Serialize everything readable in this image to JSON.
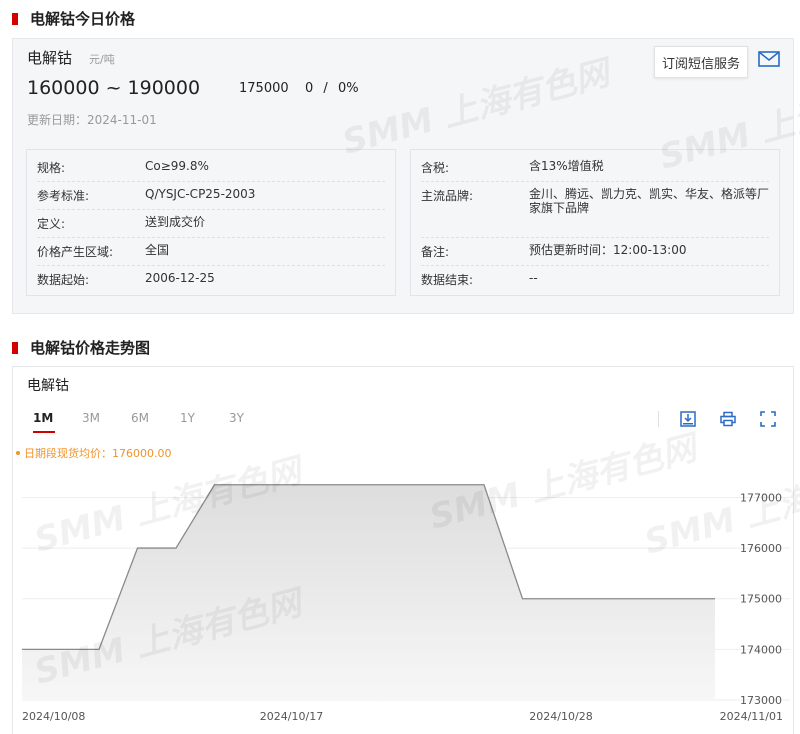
{
  "sections": {
    "price_title": "电解钴今日价格",
    "trend_title": "电解钴价格走势图"
  },
  "product": {
    "name": "电解钴",
    "unit": "元/吨",
    "price_low": "160000",
    "price_sep": "~",
    "price_high": "190000",
    "avg": "175000",
    "change": "0",
    "change_sep": "/",
    "change_pct": "0%",
    "update_date": "更新日期：2024-11-01",
    "subscribe_label": "订阅短信服务"
  },
  "specs_left": [
    {
      "key": "规格:",
      "value": "Co≥99.8%"
    },
    {
      "key": "参考标准:",
      "value": "Q/YSJC-CP25-2003"
    },
    {
      "key": "定义:",
      "value": "送到成交价"
    },
    {
      "key": "价格产生区域:",
      "value": "全国"
    },
    {
      "key": "数据起始:",
      "value": "2006-12-25"
    }
  ],
  "specs_right": [
    {
      "key": "含税:",
      "value": "含13%增值税"
    },
    {
      "key": "主流品牌:",
      "value": "金川、腾远、凯力克、凯实、华友、格派等厂家旗下品牌"
    },
    {
      "key": "备注:",
      "value": "预估更新时间：12:00-13:00"
    },
    {
      "key": "数据结束:",
      "value": "--"
    }
  ],
  "chart_card": {
    "title": "电解钴",
    "tabs": [
      "1M",
      "3M",
      "6M",
      "1Y",
      "3Y"
    ],
    "active_tab": "1M",
    "legend": "日期段现货均价：176000.00"
  },
  "watermark": {
    "brand": "SMM",
    "text": "上海有色网"
  },
  "chart_data": {
    "type": "area",
    "x": [
      "2024/10/08",
      "2024/10/09",
      "2024/10/10",
      "2024/10/11",
      "2024/10/14",
      "2024/10/15",
      "2024/10/16",
      "2024/10/17",
      "2024/10/18",
      "2024/10/21",
      "2024/10/22",
      "2024/10/23",
      "2024/10/24",
      "2024/10/25",
      "2024/10/28",
      "2024/10/29",
      "2024/10/30",
      "2024/10/31",
      "2024/11/01"
    ],
    "values": [
      174000,
      174000,
      174000,
      176000,
      176000,
      177250,
      177250,
      177250,
      177250,
      177250,
      177250,
      177250,
      177250,
      175000,
      175000,
      175000,
      175000,
      175000,
      175000
    ],
    "x_tick_labels": [
      "2024/10/08",
      "2024/10/17",
      "2024/10/28",
      "2024/11/01"
    ],
    "y_ticks": [
      173000,
      174000,
      175000,
      176000,
      177000
    ],
    "ylim": [
      173000,
      177700
    ],
    "y_axis_side": "right",
    "grid": "horizontal",
    "colors": {
      "line": "#8a8a8a",
      "fill_top": "#dddddd",
      "fill_bottom": "#f7f7f7"
    }
  },
  "colors": {
    "accent": "#d40000",
    "legend": "#f0932b"
  }
}
